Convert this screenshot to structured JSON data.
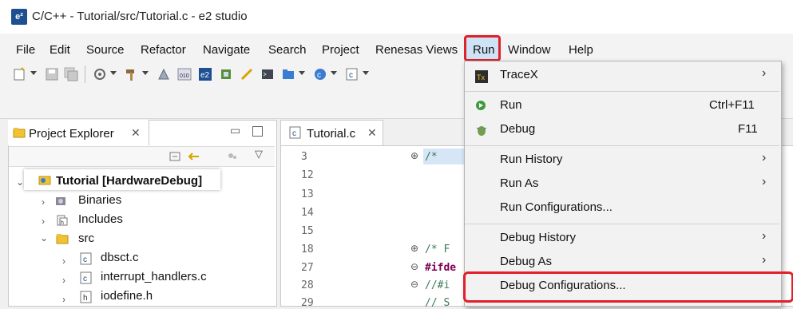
{
  "window": {
    "title": "C/C++ - Tutorial/src/Tutorial.c - e2 studio",
    "logo": "e²"
  },
  "menubar": {
    "items": [
      "File",
      "Edit",
      "Source",
      "Refactor",
      "Navigate",
      "Search",
      "Project",
      "Renesas Views",
      "Run",
      "Window",
      "Help"
    ]
  },
  "project_explorer": {
    "tab_label": "Project Explorer",
    "tree": [
      {
        "label": "Tutorial [HardwareDebug]"
      },
      {
        "label": "Binaries"
      },
      {
        "label": "Includes"
      },
      {
        "label": "src"
      },
      {
        "label": "dbsct.c"
      },
      {
        "label": "interrupt_handlers.c"
      },
      {
        "label": "iodefine.h"
      }
    ]
  },
  "editor": {
    "tab_label": "Tutorial.c",
    "line_numbers": [
      "3",
      "12",
      "13",
      "14",
      "15",
      "18",
      "27",
      "28",
      "29"
    ],
    "code_fragments": [
      "/*",
      "/*  F",
      "#ifde",
      "//#i",
      "// S"
    ]
  },
  "run_menu": {
    "traceX": "TraceX",
    "run": "Run",
    "run_shortcut": "Ctrl+F11",
    "debug": "Debug",
    "debug_shortcut": "F11",
    "run_history": "Run History",
    "run_as": "Run As",
    "run_configurations": "Run Configurations...",
    "debug_history": "Debug History",
    "debug_as": "Debug As",
    "debug_configurations": "Debug Configurations..."
  },
  "colors": {
    "highlight_red": "#e0202a",
    "menu_selected": "#cfe3f7"
  }
}
